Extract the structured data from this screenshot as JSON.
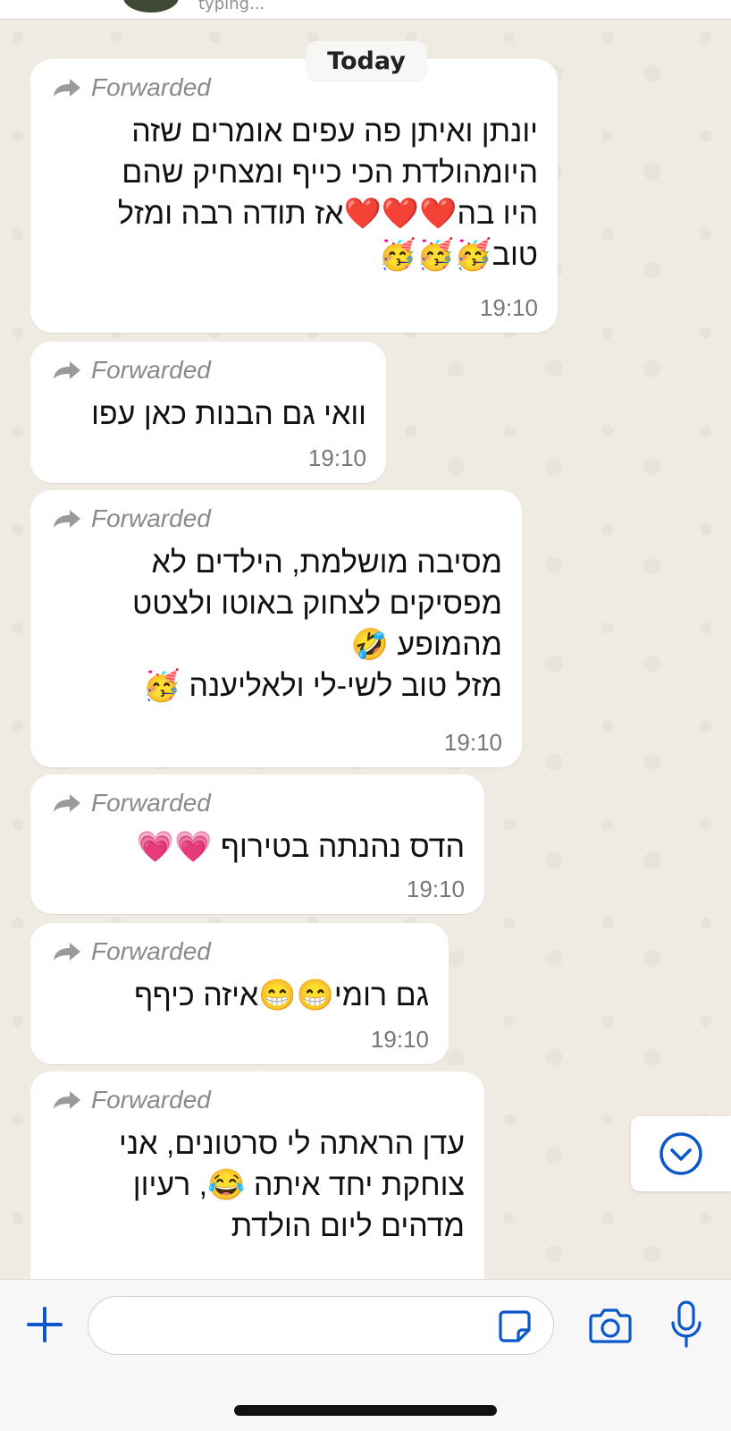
{
  "header": {
    "status_text": "typing..."
  },
  "date_label": "Today",
  "forwarded_label": "Forwarded",
  "messages": [
    {
      "lines": [
        "יונתן ואיתן פה עפים אומרים שזה",
        "היומהולדת הכי כייף ומצחיק שהם",
        "היו בה❤️❤️❤️אז תודה רבה ומזל",
        "טוב🥳🥳🥳"
      ],
      "time": "19:10"
    },
    {
      "lines": [
        "וואי גם הבנות כאן עפו"
      ],
      "time": "19:10"
    },
    {
      "lines": [
        "מסיבה מושלמת, הילדים לא",
        "מפסיקים לצחוק באוטו ולצטט",
        "מהמופע 🤣",
        "מזל טוב לשי-לי ולאליענה 🥳"
      ],
      "time": "19:10"
    },
    {
      "lines": [
        "הדס נהנתה בטירוף 💗💗"
      ],
      "time": "19:10"
    },
    {
      "lines": [
        "גם רומי😁😁איזה כיףף"
      ],
      "time": "19:10"
    },
    {
      "lines": [
        "עדן הראתה לי סרטונים, אני",
        "צוחקת יחד איתה 😂, רעיון",
        "מדהים ליום הולדת"
      ],
      "time": ""
    }
  ],
  "colors": {
    "accent": "#0a58ca",
    "bubble": "#ffffff",
    "background": "#efeae2",
    "heart_red": "#e0282e",
    "heart_pink": "#ec4aa6"
  },
  "icons": {
    "forward": "forward-arrow-icon",
    "scroll_down": "chevron-down-circle-icon",
    "plus": "plus-icon",
    "sticker": "sticker-icon",
    "camera": "camera-icon",
    "mic": "microphone-icon"
  }
}
